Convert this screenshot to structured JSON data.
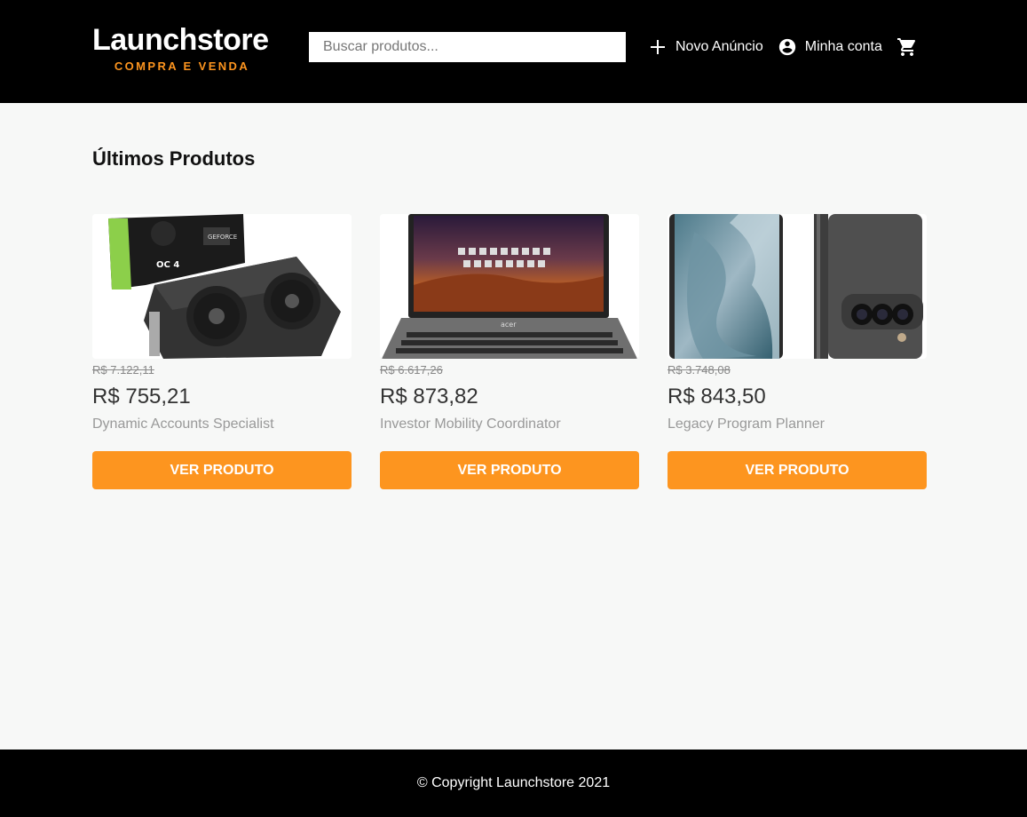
{
  "brand": {
    "title": "Launchstore",
    "subtitle": "COMPRA E VENDA",
    "accent": "#fd951f"
  },
  "search": {
    "placeholder": "Buscar produtos..."
  },
  "nav": {
    "new_listing": "Novo Anúncio",
    "account": "Minha conta",
    "cart_icon": "cart-icon",
    "add_icon": "plus-icon",
    "account_icon": "account-circle-icon"
  },
  "section": {
    "title": "Últimos Produtos"
  },
  "products": [
    {
      "image": "graphics-card-image",
      "old_price": "R$ 7.122,11",
      "price": "R$ 755,21",
      "name": "Dynamic Accounts Specialist",
      "button": "VER PRODUTO"
    },
    {
      "image": "laptop-image",
      "old_price": "R$ 6.617,26",
      "price": "R$ 873,82",
      "name": "Investor Mobility Coordinator",
      "button": "VER PRODUTO"
    },
    {
      "image": "smartphone-image",
      "old_price": "R$ 3.748,08",
      "price": "R$ 843,50",
      "name": "Legacy Program Planner",
      "button": "VER PRODUTO"
    }
  ],
  "footer": {
    "copyright": "© Copyright Launchstore 2021"
  }
}
